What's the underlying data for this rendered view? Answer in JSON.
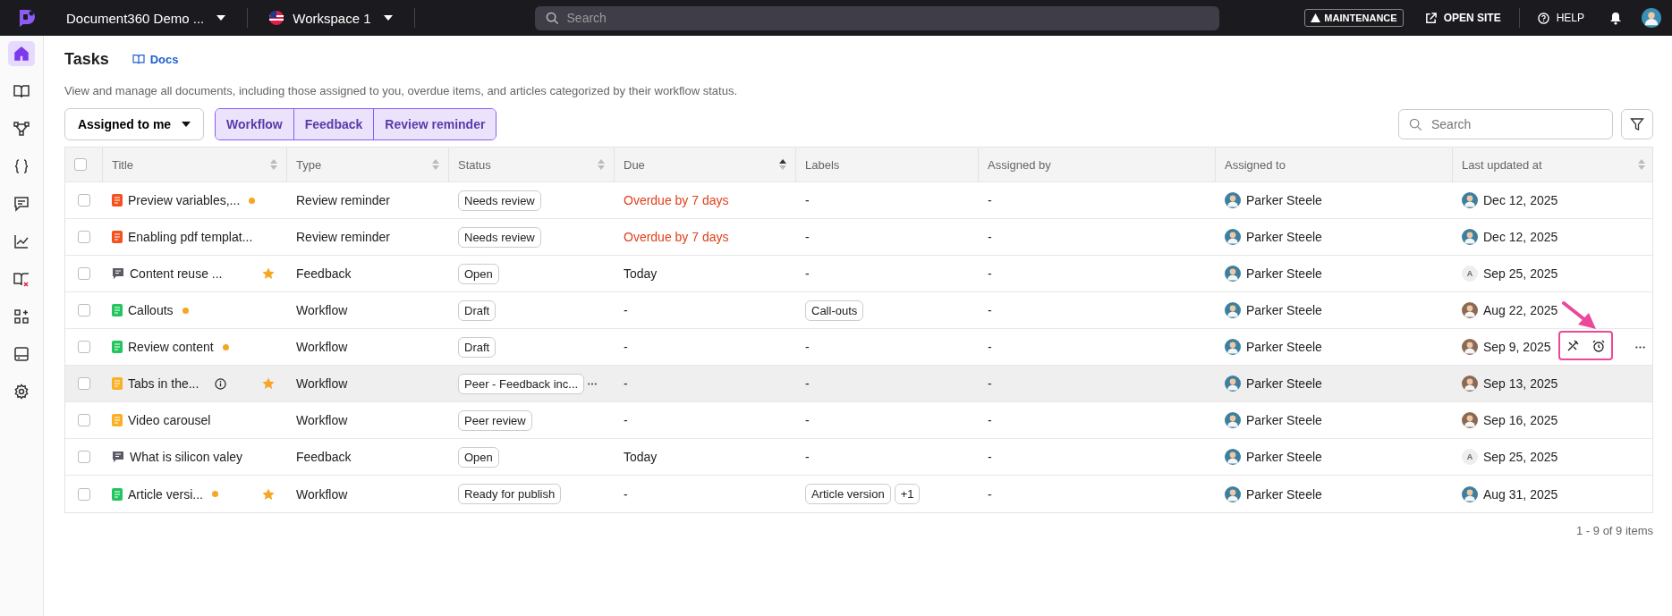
{
  "top_bar": {
    "project": "Document360 Demo ...",
    "workspace": "Workspace 1",
    "search": {
      "placeholder": "Search"
    },
    "maintenance": "MAINTENANCE",
    "open_site": "OPEN SITE",
    "help": "HELP"
  },
  "sidebar": {
    "items": [
      {
        "selected": true
      },
      {
        "selected": false
      },
      {
        "selected": false
      },
      {
        "selected": false
      },
      {
        "selected": false
      },
      {
        "selected": false
      },
      {
        "selected": false
      },
      {
        "selected": false
      },
      {
        "selected": false
      },
      {
        "selected": false
      }
    ]
  },
  "page": {
    "title": "Tasks",
    "docs_link": "Docs",
    "description": "View and manage all documents, including those assigned to you, overdue items, and articles categorized by their workflow status."
  },
  "toolbar": {
    "filter_dropdown": "Assigned to me",
    "segments": [
      {
        "label": "Workflow",
        "selected": true
      },
      {
        "label": "Feedback",
        "selected": true
      },
      {
        "label": "Review reminder",
        "selected": true
      }
    ],
    "search": {
      "placeholder": "Search"
    }
  },
  "table": {
    "all_checked": false,
    "columns": [
      {
        "label": "Title",
        "sortable": true,
        "sorted": false
      },
      {
        "label": "Type",
        "sortable": true,
        "sorted": false
      },
      {
        "label": "Status",
        "sortable": true,
        "sorted": false
      },
      {
        "label": "Due",
        "sortable": true,
        "sorted": true
      },
      {
        "label": "Labels",
        "sortable": false
      },
      {
        "label": "Assigned by",
        "sortable": false
      },
      {
        "label": "Assigned to",
        "sortable": false
      },
      {
        "label": "Last updated at",
        "sortable": true,
        "sorted": false
      }
    ],
    "rows": [
      {
        "checked": false,
        "doc": {
          "kind": "document",
          "color": "#f4511e"
        },
        "title": "Preview variables,...",
        "unread": true,
        "info": false,
        "starred": false,
        "type": "Review reminder",
        "status": "Needs review",
        "status_more": false,
        "due": "Overdue by 7 days",
        "overdue": true,
        "labels": [],
        "labels_empty": "-",
        "assigned_by": "-",
        "assigned_to": "Parker Steele",
        "updated_avatar": {
          "kind": "photo",
          "color": "#3d7f9e"
        },
        "updated": "Dec 12, 2025",
        "highlighted": false,
        "actions_shown": false
      },
      {
        "checked": false,
        "doc": {
          "kind": "document",
          "color": "#f4511e"
        },
        "title": "Enabling pdf templat...",
        "unread": false,
        "info": false,
        "starred": false,
        "type": "Review reminder",
        "status": "Needs review",
        "status_more": false,
        "due": "Overdue by 7 days",
        "overdue": true,
        "labels": [],
        "labels_empty": "-",
        "assigned_by": "-",
        "assigned_to": "Parker Steele",
        "updated_avatar": {
          "kind": "photo",
          "color": "#3d7f9e"
        },
        "updated": "Dec 12, 2025",
        "highlighted": false,
        "actions_shown": false
      },
      {
        "checked": false,
        "doc": {
          "kind": "comment"
        },
        "title": "Content reuse ...",
        "unread": false,
        "info": false,
        "starred": true,
        "type": "Feedback",
        "status": "Open",
        "status_more": false,
        "due": "Today",
        "overdue": false,
        "labels": [],
        "labels_empty": "-",
        "assigned_by": "-",
        "assigned_to": "Parker Steele",
        "updated_avatar": {
          "kind": "initial",
          "initial": "A"
        },
        "updated": "Sep 25, 2025",
        "highlighted": false,
        "actions_shown": false
      },
      {
        "checked": false,
        "doc": {
          "kind": "document",
          "color": "#22c55e"
        },
        "title": "Callouts",
        "unread": true,
        "info": false,
        "starred": false,
        "type": "Workflow",
        "status": "Draft",
        "status_more": false,
        "due": "-",
        "overdue": false,
        "labels": [
          "Call-outs"
        ],
        "assigned_by": "-",
        "assigned_to": "Parker Steele",
        "updated_avatar": {
          "kind": "photo",
          "color": "#8a6a55"
        },
        "updated": "Aug 22, 2025",
        "highlighted": false,
        "actions_shown": false
      },
      {
        "checked": false,
        "doc": {
          "kind": "document",
          "color": "#22c55e"
        },
        "title": "Review content",
        "unread": true,
        "info": false,
        "starred": false,
        "type": "Workflow",
        "status": "Draft",
        "status_more": false,
        "due": "-",
        "overdue": false,
        "labels": [],
        "labels_empty": "-",
        "assigned_by": "-",
        "assigned_to": "Parker Steele",
        "updated_avatar": {
          "kind": "photo",
          "color": "#8a6a55"
        },
        "updated": "Sep 9, 2025",
        "highlighted": false,
        "actions_shown": true
      },
      {
        "checked": false,
        "doc": {
          "kind": "document",
          "color": "#fbb024"
        },
        "title": "Tabs in the...",
        "unread": false,
        "info": true,
        "starred": true,
        "type": "Workflow",
        "status": "Peer - Feedback inc...",
        "status_more": true,
        "due": "-",
        "overdue": false,
        "labels": [],
        "labels_empty": "-",
        "assigned_by": "-",
        "assigned_to": "Parker Steele",
        "updated_avatar": {
          "kind": "photo",
          "color": "#8a6a55"
        },
        "updated": "Sep 13, 2025",
        "highlighted": true,
        "actions_shown": false
      },
      {
        "checked": false,
        "doc": {
          "kind": "document",
          "color": "#fbb024"
        },
        "title": "Video carousel",
        "unread": false,
        "info": false,
        "starred": false,
        "type": "Workflow",
        "status": "Peer review",
        "status_more": false,
        "due": "-",
        "overdue": false,
        "labels": [],
        "labels_empty": "-",
        "assigned_by": "-",
        "assigned_to": "Parker Steele",
        "updated_avatar": {
          "kind": "photo",
          "color": "#8a6a55"
        },
        "updated": "Sep 16, 2025",
        "highlighted": false,
        "actions_shown": false
      },
      {
        "checked": false,
        "doc": {
          "kind": "comment"
        },
        "title": "What is silicon valey",
        "unread": false,
        "info": false,
        "starred": false,
        "type": "Feedback",
        "status": "Open",
        "status_more": false,
        "due": "Today",
        "overdue": false,
        "labels": [],
        "labels_empty": "-",
        "assigned_by": "-",
        "assigned_to": "Parker Steele",
        "updated_avatar": {
          "kind": "initial",
          "initial": "A"
        },
        "updated": "Sep 25, 2025",
        "highlighted": false,
        "actions_shown": false
      },
      {
        "checked": false,
        "doc": {
          "kind": "document",
          "color": "#22c55e"
        },
        "title": "Article versi...",
        "unread": true,
        "info": false,
        "starred": true,
        "type": "Workflow",
        "status": "Ready for publish",
        "status_more": false,
        "due": "-",
        "overdue": false,
        "labels": [
          "Article version",
          "+1"
        ],
        "assigned_by": "-",
        "assigned_to": "Parker Steele",
        "updated_avatar": {
          "kind": "photo",
          "color": "#3d7f9e"
        },
        "updated": "Aug 31, 2025",
        "highlighted": false,
        "actions_shown": false
      }
    ]
  },
  "pagination": "1 - 9 of 9 items"
}
